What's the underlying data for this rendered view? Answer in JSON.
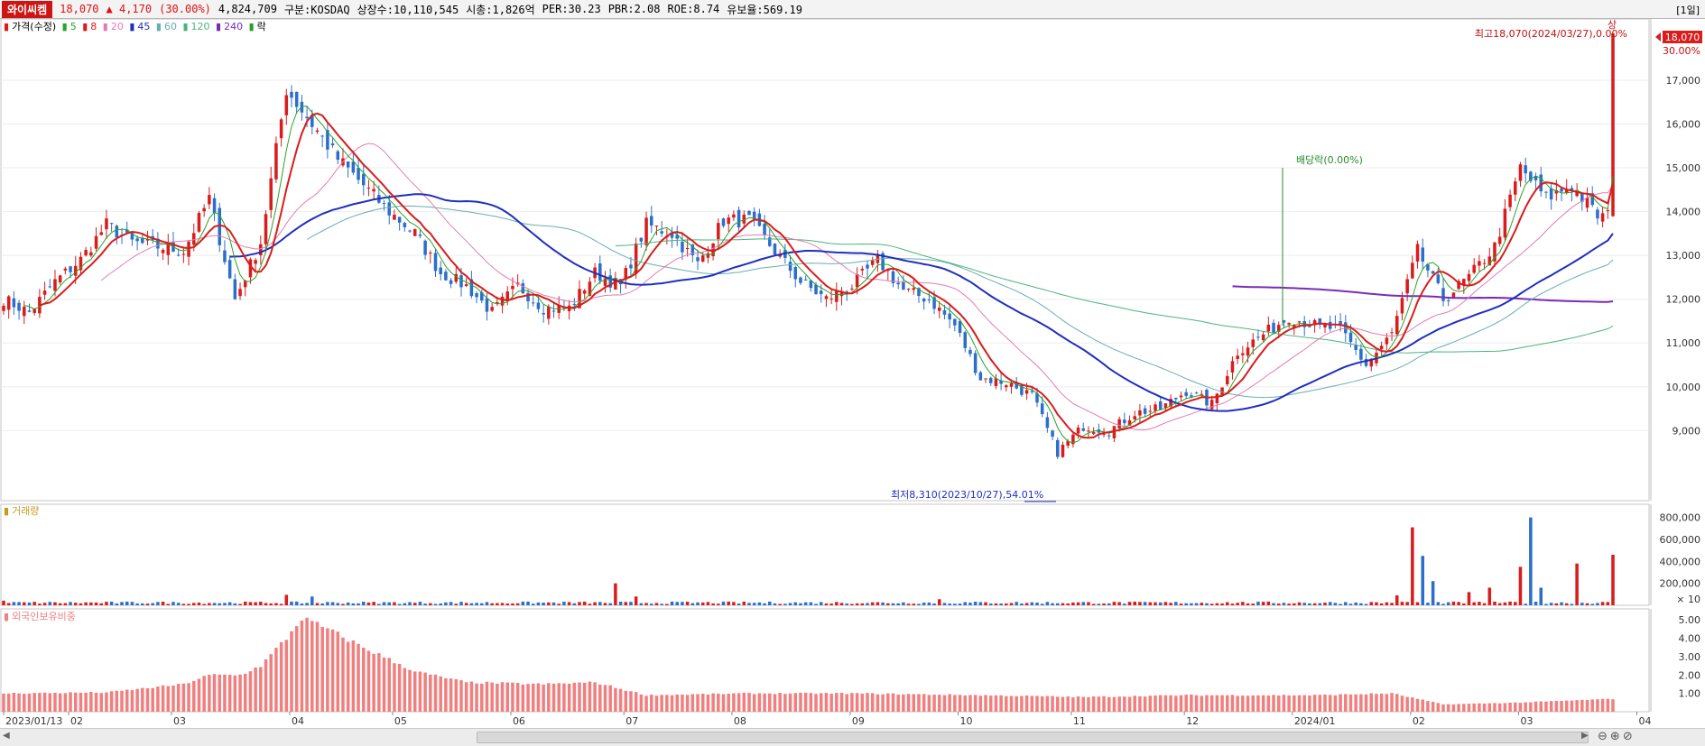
{
  "header": {
    "name": "와이씨켐",
    "price": "18,070",
    "change": "▲ 4,170",
    "change_pct": "(30.00%)",
    "volume": "4,824,709",
    "market": "구분:KOSDAQ",
    "shares": "상장수:10,110,545",
    "mktcap": "시총:1,826억",
    "per": "PER:30.23",
    "pbr": "PBR:2.08",
    "roe": "ROE:8.74",
    "reserve": "유보율:569.19",
    "period": "[1일]"
  },
  "legend": {
    "price": "가격(수정)",
    "ma5": "5",
    "ma8": "8",
    "ma20": "20",
    "ma45": "45",
    "ma60": "60",
    "ma120": "120",
    "ma240": "240",
    "ex": "락"
  },
  "colors": {
    "up": "#d91c1c",
    "down": "#2b6fcb",
    "ma5": "#29a329",
    "ma8": "#d91c1c",
    "ma20": "#e37cb4",
    "ma45": "#1f2fbf",
    "ma60": "#68aeb0",
    "ma120": "#4ab480",
    "ma240": "#7a2cb4",
    "foreign": "#f08080"
  },
  "annotations": {
    "high": "최고18,070(2024/03/27),0.00%",
    "high_tag": "상",
    "low": "최저8,310(2023/10/27),54.01%",
    "dividend": "배당락(0.00%)",
    "last_price": "18,070",
    "last_pct": "30.00%"
  },
  "chart_data": [
    {
      "type": "candlestick",
      "title": "가격(수정)",
      "ylim": [
        7400,
        18400
      ],
      "yticks": [
        "9,000",
        "10,000",
        "11,000",
        "12,000",
        "13,000",
        "14,000",
        "15,000",
        "16,000",
        "17,000"
      ],
      "anchors": [
        [
          "2023-01-13",
          12000
        ],
        [
          "2023-01-20",
          11700
        ],
        [
          "2023-01-27",
          12400
        ],
        [
          "2023-02-03",
          12900
        ],
        [
          "2023-02-10",
          13700
        ],
        [
          "2023-02-17",
          13300
        ],
        [
          "2023-02-24",
          13200
        ],
        [
          "2023-03-03",
          13100
        ],
        [
          "2023-03-10",
          14300
        ],
        [
          "2023-03-17",
          12000
        ],
        [
          "2023-03-24",
          13300
        ],
        [
          "2023-03-31",
          16800
        ],
        [
          "2023-04-07",
          16000
        ],
        [
          "2023-04-14",
          15200
        ],
        [
          "2023-04-21",
          14600
        ],
        [
          "2023-04-28",
          14000
        ],
        [
          "2023-05-05",
          13500
        ],
        [
          "2023-05-12",
          12600
        ],
        [
          "2023-05-19",
          12300
        ],
        [
          "2023-05-26",
          11700
        ],
        [
          "2023-06-02",
          12300
        ],
        [
          "2023-06-09",
          11800
        ],
        [
          "2023-06-16",
          11800
        ],
        [
          "2023-06-23",
          12600
        ],
        [
          "2023-06-30",
          12300
        ],
        [
          "2023-07-07",
          13700
        ],
        [
          "2023-07-14",
          13500
        ],
        [
          "2023-07-21",
          12800
        ],
        [
          "2023-07-28",
          13800
        ],
        [
          "2023-08-04",
          13800
        ],
        [
          "2023-08-11",
          13100
        ],
        [
          "2023-08-18",
          12400
        ],
        [
          "2023-08-25",
          12000
        ],
        [
          "2023-09-01",
          12300
        ],
        [
          "2023-09-08",
          12900
        ],
        [
          "2023-09-15",
          12200
        ],
        [
          "2023-09-22",
          12000
        ],
        [
          "2023-09-29",
          11400
        ],
        [
          "2023-10-06",
          10200
        ],
        [
          "2023-10-13",
          10100
        ],
        [
          "2023-10-20",
          9800
        ],
        [
          "2023-10-27",
          8500
        ],
        [
          "2023-11-03",
          9100
        ],
        [
          "2023-11-10",
          9000
        ],
        [
          "2023-11-17",
          9400
        ],
        [
          "2023-11-24",
          9500
        ],
        [
          "2023-12-01",
          9900
        ],
        [
          "2023-12-08",
          9600
        ],
        [
          "2023-12-15",
          10800
        ],
        [
          "2023-12-22",
          11200
        ],
        [
          "2023-12-29",
          11600
        ],
        [
          "2024-01-05",
          11400
        ],
        [
          "2024-01-12",
          11300
        ],
        [
          "2024-01-19",
          10500
        ],
        [
          "2024-01-26",
          11200
        ],
        [
          "2024-02-02",
          13100
        ],
        [
          "2024-02-09",
          12000
        ],
        [
          "2024-02-16",
          12500
        ],
        [
          "2024-02-23",
          13200
        ],
        [
          "2024-03-01",
          15000
        ],
        [
          "2024-03-08",
          14300
        ],
        [
          "2024-03-15",
          14600
        ],
        [
          "2024-03-22",
          13900
        ],
        [
          "2024-03-26",
          13900
        ],
        [
          "2024-03-27",
          18070
        ]
      ],
      "x_ticks": [
        "2023/01/13",
        "02",
        "03",
        "04",
        "05",
        "06",
        "07",
        "08",
        "09",
        "10",
        "11",
        "12",
        "2024/01",
        "02",
        "03",
        "04"
      ]
    },
    {
      "type": "bar",
      "title": "거래량",
      "ylim": [
        0,
        920000
      ],
      "yticks": [
        "200,000",
        "400,000",
        "600,000",
        "800,000"
      ],
      "unit": "× 10",
      "spikes": [
        [
          "2023-01-13",
          42000
        ],
        [
          "2023-02-24",
          30000
        ],
        [
          "2023-03-31",
          95000
        ],
        [
          "2023-04-07",
          80000
        ],
        [
          "2023-06-29",
          200000
        ],
        [
          "2023-07-05",
          80000
        ],
        [
          "2023-09-26",
          55000
        ],
        [
          "2023-11-20",
          30000
        ],
        [
          "2024-01-29",
          90000
        ],
        [
          "2024-02-01",
          710000
        ],
        [
          "2024-02-05",
          450000
        ],
        [
          "2024-02-07",
          220000
        ],
        [
          "2024-02-16",
          120000
        ],
        [
          "2024-02-22",
          160000
        ],
        [
          "2024-03-01",
          350000
        ],
        [
          "2024-03-05",
          800000
        ],
        [
          "2024-03-07",
          160000
        ],
        [
          "2024-03-18",
          380000
        ],
        [
          "2024-03-27",
          460000
        ]
      ]
    },
    {
      "type": "bar",
      "title": "외국인보유비중",
      "ylim": [
        0,
        5.6
      ],
      "yticks": [
        "1.00",
        "2.00",
        "3.00",
        "4.00",
        "5.00"
      ],
      "anchors": [
        [
          "2023-01-13",
          1.0
        ],
        [
          "2023-02-10",
          1.05
        ],
        [
          "2023-03-03",
          1.5
        ],
        [
          "2023-03-10",
          2.0
        ],
        [
          "2023-03-20",
          2.0
        ],
        [
          "2023-03-24",
          2.5
        ],
        [
          "2023-03-31",
          4.0
        ],
        [
          "2023-04-05",
          5.1
        ],
        [
          "2023-04-12",
          4.5
        ],
        [
          "2023-04-21",
          3.5
        ],
        [
          "2023-05-05",
          2.2
        ],
        [
          "2023-05-19",
          1.6
        ],
        [
          "2023-06-09",
          1.5
        ],
        [
          "2023-06-23",
          1.6
        ],
        [
          "2023-07-07",
          0.9
        ],
        [
          "2023-08-04",
          1.0
        ],
        [
          "2023-09-01",
          1.0
        ],
        [
          "2023-10-06",
          0.9
        ],
        [
          "2023-11-03",
          0.8
        ],
        [
          "2023-12-01",
          0.9
        ],
        [
          "2024-01-05",
          0.9
        ],
        [
          "2024-01-26",
          1.0
        ],
        [
          "2024-02-09",
          0.4
        ],
        [
          "2024-03-01",
          0.5
        ],
        [
          "2024-03-27",
          0.7
        ]
      ]
    }
  ]
}
